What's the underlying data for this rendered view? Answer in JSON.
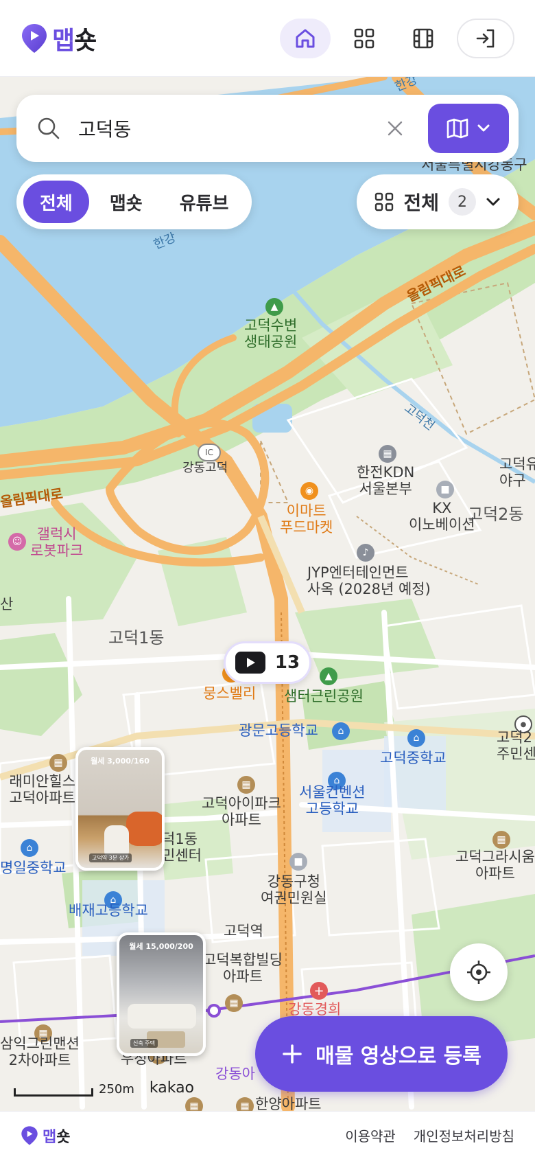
{
  "header": {
    "brand_part1": "맵",
    "brand_part2": "숏",
    "nav": [
      {
        "icon": "home-icon",
        "active": true
      },
      {
        "icon": "grid-icon",
        "active": false
      },
      {
        "icon": "film-icon",
        "active": false
      },
      {
        "icon": "login-icon",
        "active": false
      }
    ]
  },
  "search": {
    "query": "고덕동",
    "toggle_icon": "map-icon"
  },
  "filters": {
    "tabs": [
      "전체",
      "맵숏",
      "유튜브"
    ],
    "active": "전체"
  },
  "category": {
    "label": "전체",
    "count": "2"
  },
  "map": {
    "cluster_count": "13",
    "labels": {
      "olympic1": "올림픽대로",
      "olympic2": "올림픽대로",
      "hangang": "한강",
      "hangang2": "한강",
      "park1": "고덕수변\n생태공원",
      "ic": "강동고덕",
      "kepco": "한전KDN\n서울본부",
      "kx": "KX\n이노베이션",
      "emart": "이마트\n푸드마켓",
      "jyp": "JYP엔터테인먼트\n사옥 (2028년 예정)",
      "gallery": "갤럭시\n로봇파크",
      "godeok1": "고덕1동",
      "godeok2": "고덕2동",
      "moongs": "뭉스벨리",
      "samteo": "샘터근린공원",
      "gwangmun": "광문고등학교",
      "godeokmid": "고덕중학교",
      "raemian": "래미안힐스\n고덕아파트",
      "ipark": "고덕아이파크\n아파트",
      "convention": "서울컨벤션\n고등학교",
      "gangdonggu": "강동구청\n여권민원실",
      "baejae": "배재고등학교",
      "ilmid": "명일중학교",
      "station": "고덕역",
      "complex": "고덕복합빌딩\n아파트",
      "grace": "고덕그라시움\n아파트",
      "samik": "삼익그린맨션\n2차아파트",
      "woosung": "우성아파트",
      "hanyang": "한양아파트",
      "stream": "고덕천",
      "community": "고덕2\n주민센",
      "yagu": "고덕유\n야구",
      "gangdongA": "강동아",
      "seoul_border": "서울특별시강동구",
      "hospital": "강동경희",
      "center1": "덕1동\n민센터",
      "san": "산"
    },
    "thumbnails": [
      {
        "price": "월세 3,000/160",
        "tag": "고덕역 3분 상가"
      },
      {
        "price": "월세 15,000/200",
        "tag": "신축 주택"
      }
    ],
    "scale": "250m",
    "provider": "kakao"
  },
  "register_button": "매물 영상으로 등록",
  "footer": {
    "brand_part1": "맵",
    "brand_part2": "숏",
    "links": [
      "이용약관",
      "개인정보처리방침"
    ]
  },
  "colors": {
    "accent": "#6a4ee0",
    "water": "#a8d3ee",
    "park": "#c6e5b4",
    "road": "#f5b66a"
  }
}
